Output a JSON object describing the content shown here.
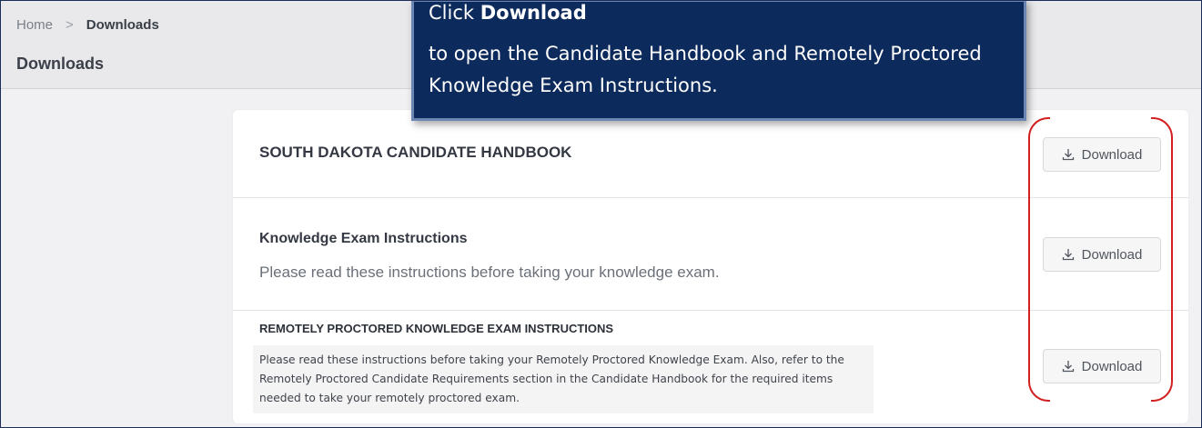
{
  "breadcrumb": {
    "home": "Home",
    "separator": ">",
    "current": "Downloads"
  },
  "page": {
    "title": "Downloads"
  },
  "callout": {
    "prefix": "Click ",
    "emphasis": "Download",
    "body": "to open the Candidate Handbook and Remotely Proctored Knowledge Exam Instructions."
  },
  "downloads": [
    {
      "title": "SOUTH DAKOTA CANDIDATE HANDBOOK",
      "description": "",
      "button_label": "Download"
    },
    {
      "title": "Knowledge Exam Instructions",
      "description": "Please read these instructions before taking your knowledge exam.",
      "button_label": "Download"
    },
    {
      "title": "REMOTELY PROCTORED KNOWLEDGE EXAM INSTRUCTIONS",
      "description": "Please read these instructions before taking your Remotely Proctored Knowledge Exam. Also, refer to the Remotely Proctored Candidate Requirements section in the Candidate Handbook for the required items needed to take your remotely proctored exam.",
      "button_label": "Download"
    }
  ],
  "icons": {
    "download": "download-icon"
  },
  "colors": {
    "callout_bg": "#0d2a5c",
    "highlight": "#d21f1f",
    "border": "#1c2d57"
  }
}
